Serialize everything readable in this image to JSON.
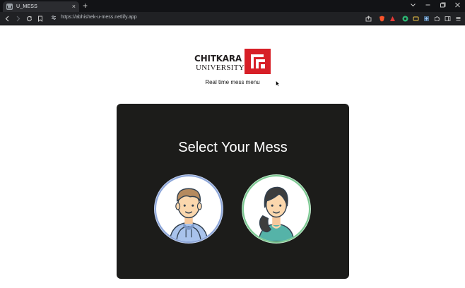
{
  "browser": {
    "tab_title": "U_MESS",
    "url": "https://abhishek-u-mess.netlify.app",
    "new_tab_symbol": "+",
    "close_tab_symbol": "×"
  },
  "page": {
    "logo": {
      "line1": "CHITKARA",
      "line2": "UNIVERSITY",
      "brand_color": "#d71f27"
    },
    "subtitle": "Real time mess menu",
    "card": {
      "title": "Select Your Mess",
      "options": [
        {
          "id": "boys",
          "icon": "boy-avatar-icon",
          "ring_color": "#8da6d8"
        },
        {
          "id": "girls",
          "icon": "girl-avatar-icon",
          "ring_color": "#7cc892"
        }
      ]
    }
  }
}
